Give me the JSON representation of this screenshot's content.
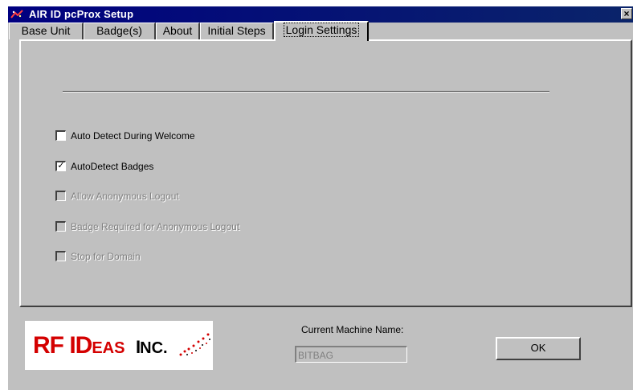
{
  "window": {
    "title": "AIR ID pcProx Setup",
    "close_glyph": "×"
  },
  "tabs": [
    {
      "label": "Base Unit"
    },
    {
      "label": "Badge(s)"
    },
    {
      "label": "About"
    },
    {
      "label": "Initial Steps"
    },
    {
      "label": "Login Settings",
      "active": true
    }
  ],
  "options": [
    {
      "label": "Auto Detect During Welcome",
      "checked": false,
      "enabled": true,
      "check_glyph": ""
    },
    {
      "label": "AutoDetect Badges",
      "checked": true,
      "enabled": true,
      "check_glyph": "✓"
    },
    {
      "label": "Allow Anonymous Logout",
      "checked": false,
      "enabled": false,
      "check_glyph": ""
    },
    {
      "label": "Badge Required for Anonymous Logout",
      "checked": false,
      "enabled": false,
      "check_glyph": ""
    },
    {
      "label": "Stop for Domain",
      "checked": false,
      "enabled": false,
      "check_glyph": ""
    }
  ],
  "footer": {
    "logo_text": {
      "big1": "RF ID",
      "small1": "EAS ",
      "big2": "I",
      "small2": "NC."
    },
    "machine_label": "Current Machine Name:",
    "machine_value": "BITBAG",
    "ok_label": "OK"
  },
  "colors": {
    "titlebar": "#000080",
    "dialog_bg": "#c0c0c0",
    "logo_red": "#d40000",
    "disabled_text": "#808080"
  }
}
